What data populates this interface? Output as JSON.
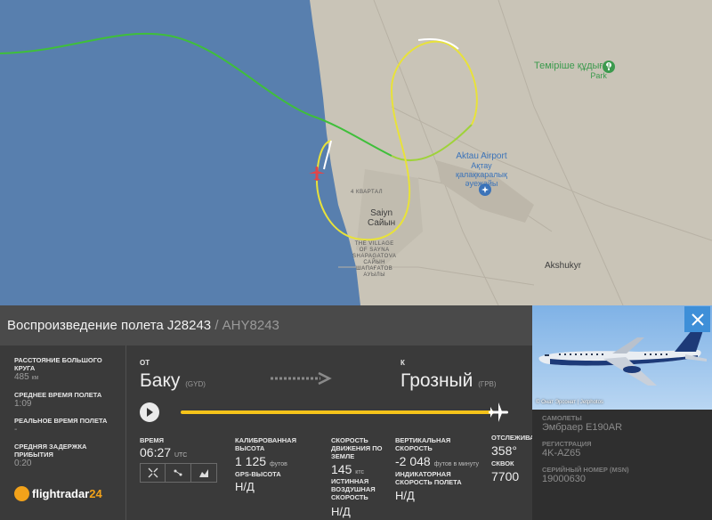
{
  "map": {
    "labels": {
      "park_name": "Теміріше құдығы",
      "park_type": "Park",
      "airport_name": "Aktau Airport",
      "airport_local": "Ақтау",
      "airport_local2": "қалақкаралық",
      "airport_local3": "әуежайы",
      "district": "4 КВАРТАЛ",
      "town": "Saiyn",
      "town_local": "Сайын",
      "village_l1": "THE VILLAGE",
      "village_l2": "OF SAYNA",
      "village_l3": "SHAPAGATOVA",
      "village_l4": "САЙЫН",
      "village_l5": "ШАПАҒАТОВ",
      "village_l6": "АУЫЛЫ",
      "akshukyr": "Akshukyr"
    }
  },
  "header": {
    "title": "Воспроизведение полета J28243",
    "separator": " / ",
    "callsign": "AHY8243"
  },
  "stats": [
    {
      "label": "Расстояние большого круга",
      "value": "485",
      "unit": "км"
    },
    {
      "label": "Среднее время полета",
      "value": "1:09",
      "unit": ""
    },
    {
      "label": "Реальное время полета",
      "value": "-",
      "unit": ""
    },
    {
      "label": "Средняя задержка прибытия",
      "value": "0:20",
      "unit": ""
    }
  ],
  "logo": {
    "text": "flightradar",
    "num": "24"
  },
  "route": {
    "from_caption": "ОТ",
    "from_city": "Баку",
    "from_code": "(GYD)",
    "to_caption": "К",
    "to_city": "Грозный",
    "to_code": "(ГРВ)",
    "progress": 1.0
  },
  "telemetry": {
    "time_label": "Время",
    "time_value": "06:27",
    "time_unit": "UTC",
    "alt_label": "Калиброванная высота",
    "alt_value": "1 125",
    "alt_unit": "футов",
    "gps_label": "GPS-высота",
    "gps_value": "Н/Д",
    "gs_label": "Скорость движения по земле",
    "gs_value": "145",
    "gs_unit": "ктс",
    "tas_label": "Истинная воздушная скорость",
    "tas_value": "Н/Д",
    "vs_label": "Вертикальная скорость",
    "vs_value": "-2 048",
    "vs_unit": "футов в минуту",
    "ias_label": "Индикаторная скорость полета",
    "ias_value": "Н/Д",
    "track_label": "Отслеживать",
    "track_value": "358°",
    "squawk_label": "СКВОК",
    "squawk_value": "7700"
  },
  "aircraft": {
    "photo_credit": "© Онат Эрсонат | Jetphotos",
    "type_label": "Самолеты",
    "type_value": "Эмбраер E190AR",
    "reg_label": "Регистрация",
    "reg_value": "4K-AZ65",
    "msn_label": "Серийный номер (MSN)",
    "msn_value": "19000630"
  },
  "colors": {
    "sea": "#587fae",
    "land": "#c9c4b7",
    "track_green": "#3fbf3a",
    "track_yellow": "#e8e23a",
    "progress": "#f5c31a",
    "close_btn": "#3e8fd8"
  }
}
